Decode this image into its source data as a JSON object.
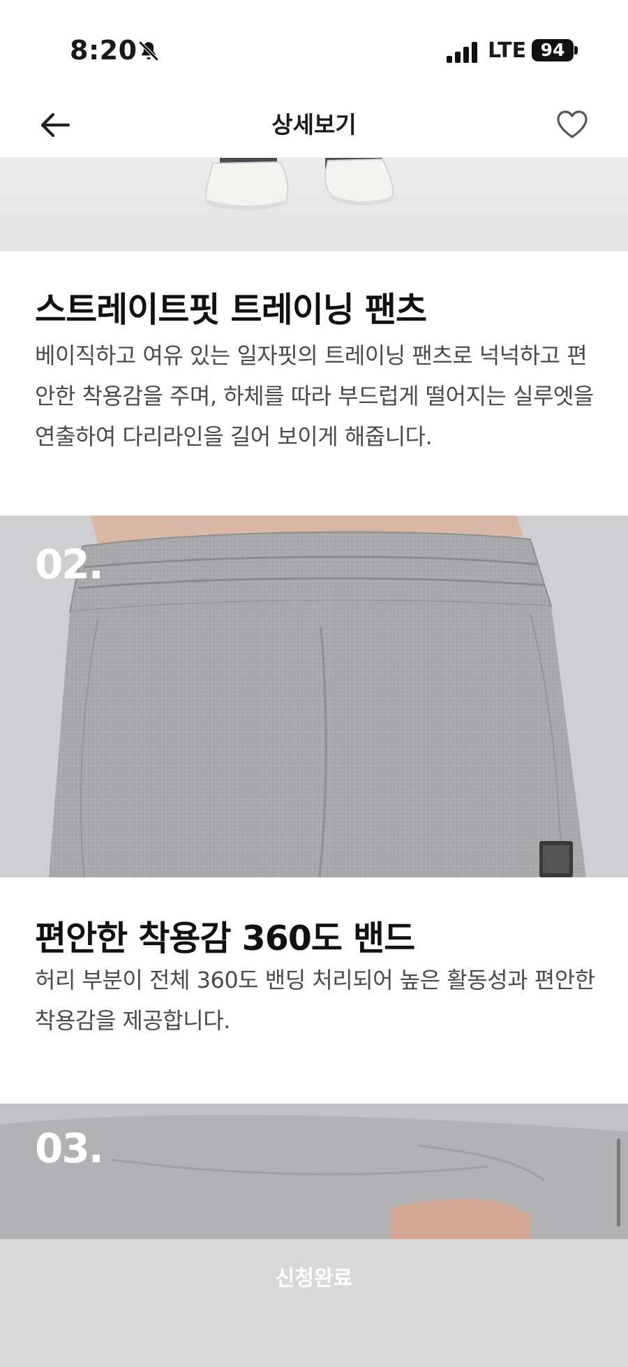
{
  "status_bar": {
    "time": "8:20",
    "network": "LTE",
    "battery": "94"
  },
  "nav": {
    "title": "상세보기"
  },
  "sections": [
    {
      "title": "스트레이트핏 트레이닝 팬츠",
      "description": "베이직하고 여유 있는 일자핏의 트레이닝 팬츠로 넉넉하고 편안한 착용감을 주며, 하체를 따라 부드럽게 떨어지는 실루엣을 연출하여 다리라인을 길어 보이게 해줍니다."
    },
    {
      "step": "02.",
      "title": "편안한 착용감 360도 밴드",
      "description": "허리 부분이 전체 360도 밴딩 처리되어 높은 활동성과 편안한 착용감을 제공합니다."
    },
    {
      "step": "03."
    }
  ],
  "bottom": {
    "button_label": "신청완료"
  },
  "colors": {
    "bottom_bar": "#d9d9d9",
    "title_text": "#111111",
    "body_text": "#4a4a4a"
  }
}
